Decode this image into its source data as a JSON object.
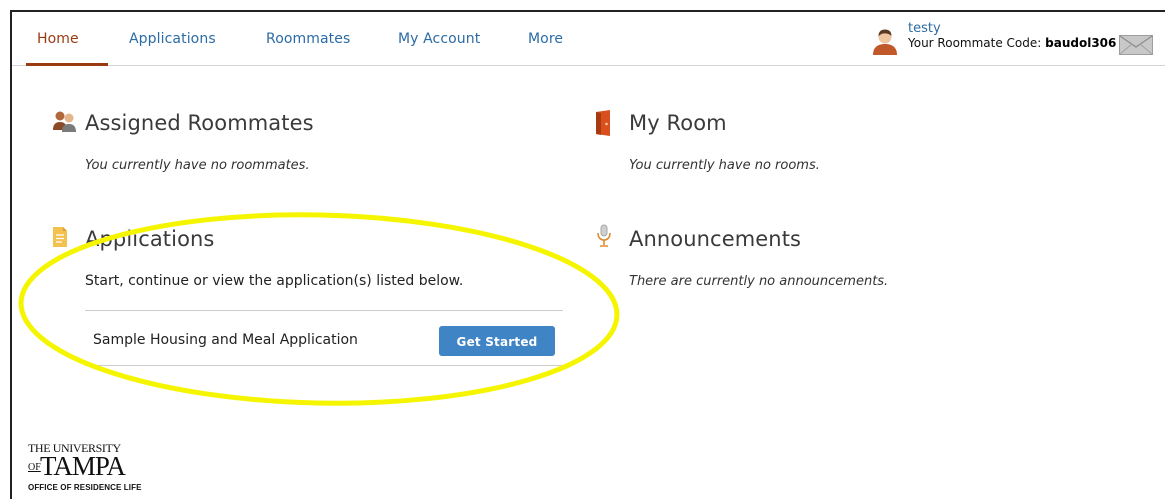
{
  "nav": {
    "items": [
      {
        "label": "Home",
        "active": true
      },
      {
        "label": "Applications",
        "active": false
      },
      {
        "label": "Roommates",
        "active": false
      },
      {
        "label": "My Account",
        "active": false
      },
      {
        "label": "More",
        "active": false
      }
    ]
  },
  "user": {
    "name": "testy",
    "code_label": "Your Roommate Code: ",
    "code_value": "baudol306"
  },
  "assigned_roommates": {
    "title": "Assigned Roommates",
    "empty_text": "You currently have no roommates."
  },
  "my_room": {
    "title": "My Room",
    "empty_text": "You currently have no rooms."
  },
  "applications": {
    "title": "Applications",
    "intro": "Start, continue or view the application(s) listed below.",
    "items": [
      {
        "name": "Sample Housing and Meal Application",
        "button_label": "Get Started"
      }
    ]
  },
  "announcements": {
    "title": "Announcements",
    "empty_text": "There are currently no announcements."
  },
  "logo": {
    "line1": "THE UNIVERSITY",
    "of": "OF",
    "name": "TAMPA",
    "line3": "OFFICE OF RESIDENCE LIFE"
  },
  "colors": {
    "nav_link": "#2c6ba5",
    "nav_active": "#9a3a12",
    "button_bg": "#3f84c5",
    "highlight": "#f5f500"
  }
}
